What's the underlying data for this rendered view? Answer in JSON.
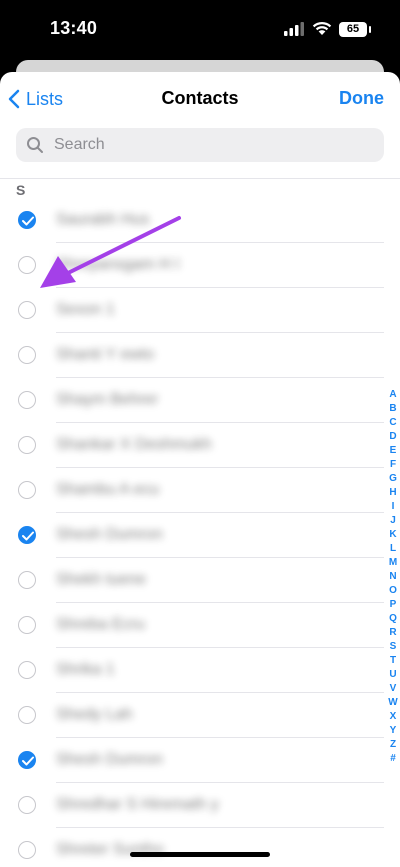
{
  "status_bar": {
    "time": "13:40",
    "battery": "65"
  },
  "nav": {
    "back_label": "Lists",
    "title": "Contacts",
    "done_label": "Done"
  },
  "search": {
    "placeholder": "Search"
  },
  "section": {
    "letter": "S"
  },
  "contacts": [
    {
      "name": "Saurabh Hus",
      "checked": true
    },
    {
      "name": "Shreyansgam H I",
      "checked": false
    },
    {
      "name": "Sexon 1",
      "checked": false
    },
    {
      "name": "Shanti Y ewto",
      "checked": false
    },
    {
      "name": "Shaym Behrer",
      "checked": false
    },
    {
      "name": "Shankar X Deshmukh",
      "checked": false
    },
    {
      "name": "Shambu A ecu",
      "checked": false
    },
    {
      "name": "Shesh Dumron",
      "checked": true
    },
    {
      "name": "Shekh tuene",
      "checked": false
    },
    {
      "name": "Shreba Ecru",
      "checked": false
    },
    {
      "name": "Shrika 1",
      "checked": false
    },
    {
      "name": "Shedy Lah",
      "checked": false
    },
    {
      "name": "Shesh Dumron",
      "checked": true
    },
    {
      "name": "Shredhar S Hiremath y",
      "checked": false
    },
    {
      "name": "Shreter Suntho",
      "checked": false
    }
  ],
  "index": [
    "A",
    "B",
    "C",
    "D",
    "E",
    "F",
    "G",
    "H",
    "I",
    "J",
    "K",
    "L",
    "M",
    "N",
    "O",
    "P",
    "Q",
    "R",
    "S",
    "T",
    "U",
    "V",
    "W",
    "X",
    "Y",
    "Z",
    "#"
  ],
  "colors": {
    "accent": "#1a84f0",
    "annotation_arrow": "#a440e8"
  }
}
